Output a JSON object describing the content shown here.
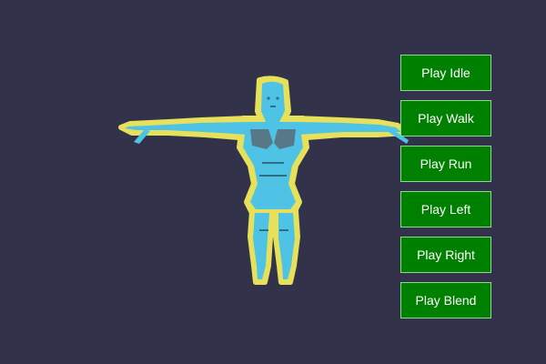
{
  "colors": {
    "background": "#32334b",
    "button_bg": "#008000",
    "button_text": "#ffffff",
    "model_primary": "#4ec3e6",
    "model_outline": "#e6e05a",
    "model_shadow": "#5a6b78"
  },
  "model": {
    "icon": "humanoid-figure-icon",
    "pose": "T-pose"
  },
  "buttons": [
    {
      "label": "Play Idle"
    },
    {
      "label": "Play Walk"
    },
    {
      "label": "Play Run"
    },
    {
      "label": "Play Left"
    },
    {
      "label": "Play Right"
    },
    {
      "label": "Play Blend"
    }
  ]
}
